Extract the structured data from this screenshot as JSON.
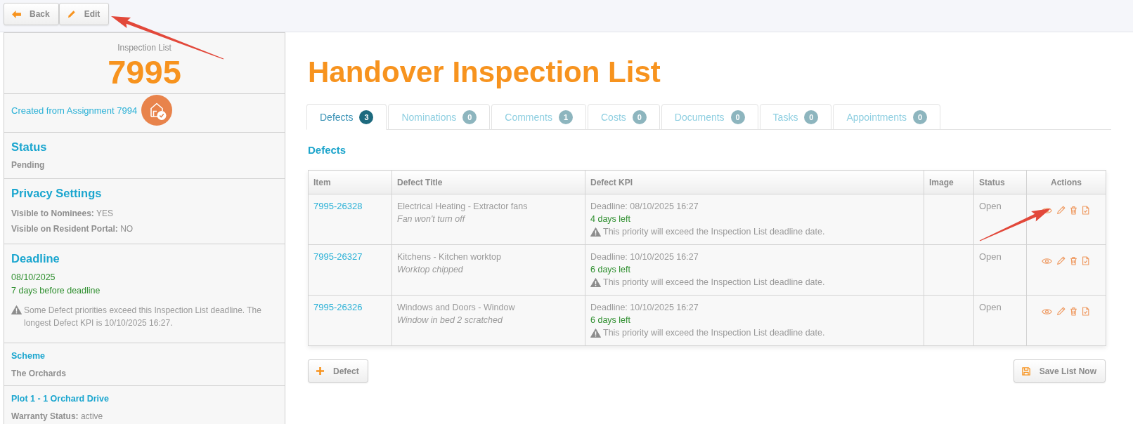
{
  "toolbar": {
    "buttons": [
      {
        "kind": "back",
        "label": "Back"
      },
      {
        "kind": "edit",
        "label": "Edit"
      }
    ]
  },
  "sidebar": {
    "caption": "Inspection List",
    "number": "7995",
    "source_link": "Created from Assignment 7994",
    "sections": [
      {
        "kind": "major",
        "heading": "Status",
        "lines": [
          {
            "kind": "value",
            "text": "Pending"
          }
        ]
      },
      {
        "kind": "major",
        "heading": "Privacy Settings",
        "lines": [
          {
            "kind": "field",
            "label": "Visible to Nominees:",
            "value": "YES"
          },
          {
            "kind": "field",
            "label": "Visible on Resident Portal:",
            "value": "NO"
          }
        ]
      },
      {
        "kind": "major",
        "heading": "Deadline",
        "lines": [
          {
            "kind": "positive",
            "text": "08/10/2025"
          },
          {
            "kind": "positive",
            "text": "7 days before deadline"
          },
          {
            "kind": "warning",
            "text": "Some Defect priorities exceed this Inspection List deadline. The longest Defect KPI is 10/10/2025 16:27."
          }
        ]
      },
      {
        "kind": "minor",
        "heading": "Scheme",
        "lines": [
          {
            "kind": "value",
            "text": "The Orchards"
          }
        ]
      },
      {
        "kind": "minor",
        "heading": "Plot 1 - 1 Orchard Drive",
        "lines": [
          {
            "kind": "field",
            "label": "Warranty Status:",
            "value": "active"
          }
        ]
      }
    ]
  },
  "page_title": "Handover Inspection List",
  "tabs": [
    {
      "label": "Defects",
      "count": "3",
      "selected": true
    },
    {
      "label": "Nominations",
      "count": "0",
      "selected": false
    },
    {
      "label": "Comments",
      "count": "1",
      "selected": false
    },
    {
      "label": "Costs",
      "count": "0",
      "selected": false
    },
    {
      "label": "Documents",
      "count": "0",
      "selected": false
    },
    {
      "label": "Tasks",
      "count": "0",
      "selected": false
    },
    {
      "label": "Appointments",
      "count": "0",
      "selected": false
    }
  ],
  "defects": {
    "heading": "Defects",
    "columns": [
      "Item",
      "Defect Title",
      "Defect KPI",
      "Image",
      "Status",
      "Actions"
    ],
    "rows": [
      {
        "item": "7995-26328",
        "title": "Electrical Heating - Extractor fans",
        "description": "Fan won't turn off",
        "deadline": "Deadline: 08/10/2025 16:27",
        "time_left": "4 days left",
        "warning": "This priority will exceed the Inspection List deadline date.",
        "status": "Open"
      },
      {
        "item": "7995-26327",
        "title": "Kitchens - Kitchen worktop",
        "description": "Worktop chipped",
        "deadline": "Deadline: 10/10/2025 16:27",
        "time_left": "6 days left",
        "warning": "This priority will exceed the Inspection List deadline date.",
        "status": "Open"
      },
      {
        "item": "7995-26326",
        "title": "Windows and Doors - Window",
        "description": "Window in bed 2 scratched",
        "deadline": "Deadline: 10/10/2025 16:27",
        "time_left": "6 days left",
        "warning": "This priority will exceed the Inspection List deadline date.",
        "status": "Open"
      }
    ]
  },
  "actions": [
    {
      "kind": "add",
      "label": "Defect"
    },
    {
      "kind": "save",
      "label": "Save List Now"
    }
  ]
}
